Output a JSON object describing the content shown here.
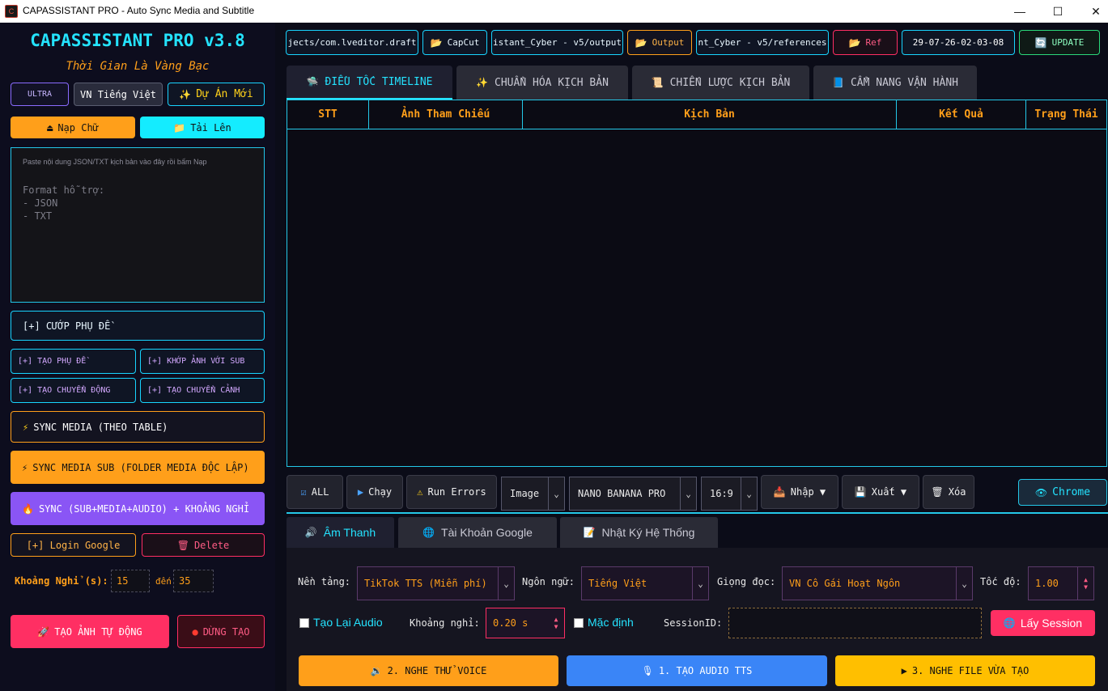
{
  "window": {
    "title": "CAPASSISTANT PRO - Auto Sync Media and Subtitle",
    "icon": "C"
  },
  "left": {
    "brand": "CAPASSISTANT PRO v3.8",
    "slogan": "Thời Gian Là Vàng Bạc",
    "ultra": "ULTRA",
    "lang": "VN Tiếng Việt",
    "new_project": "Dự Án Mới",
    "load_text": "Nạp Chữ",
    "upload": "Tải Lên",
    "paste_hint": "Paste nội dung JSON/TXT kịch bản vào đây rồi bấm Nạp",
    "format_hint": "Format hỗ trợ:\n- JSON\n- TXT",
    "steal_sub": "[+] CƯỚP PHỤ ĐỀ",
    "create_sub": "[+] TẠO PHỤ ĐỀ",
    "match_img": "[+] KHỚP ẢNH VỚI SUB",
    "create_motion": "[+] TẠO CHUYỂN ĐỘNG",
    "create_transition": "[+] TẠO CHUYỂN CẢNH",
    "sync_table": "SYNC MEDIA (THEO TABLE)",
    "sync_folder": "SYNC MEDIA SUB (FOLDER MEDIA ĐỘC LẬP)",
    "sync_all": "SYNC (SUB+MEDIA+AUDIO) + KHOẢNG NGHỈ",
    "login_google": "[+] Login Google",
    "delete": "Delete",
    "pause_label": "Khoảng Nghỉ (s):",
    "pause_from": "15",
    "pause_to_label": "đến",
    "pause_to": "35",
    "auto_image": "TẠO ẢNH TỰ ĐỘNG",
    "stop": "DỪNG TẠO"
  },
  "topbar": {
    "path1": "jects/com.lveditor.draft",
    "capcut": "CapCut",
    "path2": "istant_Cyber - v5/output",
    "output": "Output",
    "path3": "nt_Cyber - v5/references",
    "ref": "Ref",
    "timestamp": "29-07-26-02-03-08",
    "update": "UPDATE"
  },
  "tabs": [
    "ĐIỀU TỐC TIMELINE",
    "CHUẨN HÓA KỊCH BẢN",
    "CHIẾN LƯỢC KỊCH BẢN",
    "CẨM NANG VẬN HÀNH"
  ],
  "table": {
    "headers": [
      "STT",
      "Ảnh Tham Chiếu",
      "Kịch Bản",
      "Kết Quả",
      "Trạng Thái"
    ]
  },
  "toolbar": {
    "all": "ALL",
    "run": "Chạy",
    "run_errors": "Run Errors",
    "media_type": "Image",
    "model": "NANO BANANA PRO",
    "ratio": "16:9",
    "import": "Nhập ▼",
    "export": "Xuất ▼",
    "delete": "Xóa",
    "chrome": "Chrome"
  },
  "bottom_tabs": [
    "Âm Thanh",
    "Tài Khoản Google",
    "Nhật Ký Hệ Thống"
  ],
  "audio": {
    "platform_label": "Nền tảng:",
    "platform": "TikTok TTS (Miễn phí)",
    "lang_label": "Ngôn ngữ:",
    "lang": "Tiếng Việt",
    "voice_label": "Giọng đọc:",
    "voice": "VN Cô Gái Hoạt Ngôn",
    "speed_label": "Tốc độ:",
    "speed": "1.00",
    "regen": "Tạo Lại Audio",
    "pause_label": "Khoảng nghỉ:",
    "pause": "0.20 s",
    "default": "Mặc định",
    "session_label": "SessionID:",
    "session_value": "",
    "get_session": "Lấy Session",
    "preview_voice": "2. NGHE THỬ VOICE",
    "create_audio": "1. TẠO AUDIO TTS",
    "play_file": "3. NGHE FILE VỪA TẠO"
  }
}
